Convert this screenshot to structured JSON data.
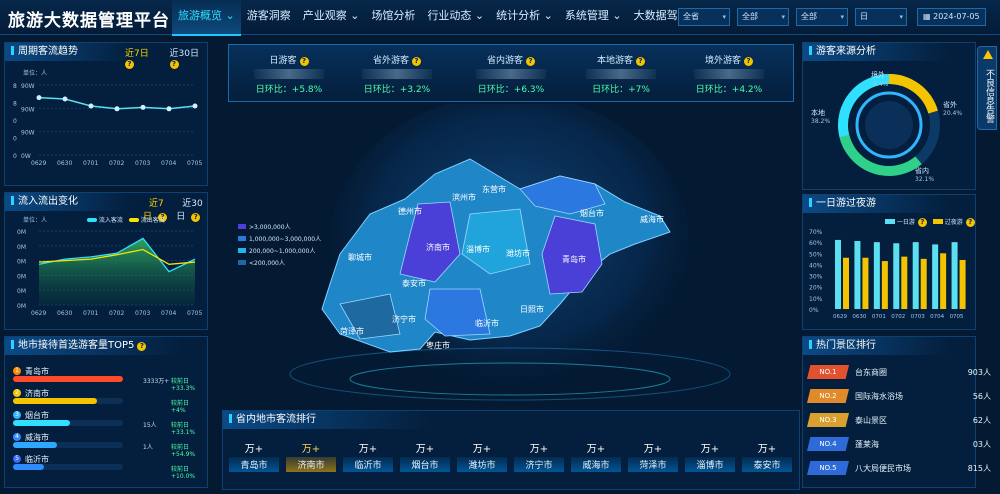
{
  "brand": "旅游大数据管理平台",
  "nav": [
    {
      "label": "旅游概览 ⌄",
      "active": true
    },
    {
      "label": "游客洞察",
      "active": false
    },
    {
      "label": "产业观察 ⌄",
      "active": false
    },
    {
      "label": "场馆分析",
      "active": false
    },
    {
      "label": "行业动态 ⌄",
      "active": false
    },
    {
      "label": "统计分析 ⌄",
      "active": false
    },
    {
      "label": "系统管理 ⌄",
      "active": false
    },
    {
      "label": "大数据驾信 ⌄",
      "active": false
    }
  ],
  "filters": [
    {
      "value": "全省"
    },
    {
      "value": "全部"
    },
    {
      "value": "全部"
    },
    {
      "value": "日"
    }
  ],
  "date": "2024-07-05",
  "colors": {
    "accent": "#24c6ff",
    "yellow": "#f5c400",
    "green": "#49ffaa"
  },
  "weekly": {
    "title": "周期客流趋势",
    "tab7": "近7日",
    "tab30": "近30日",
    "unit": "单位：人",
    "y_ticks": [
      "8",
      "8",
      "0",
      "0",
      "0"
    ],
    "y_right": [
      "90W",
      "90W",
      "90W",
      "0W"
    ],
    "chart_data": {
      "type": "line",
      "categories": [
        "0629",
        "0630",
        "0701",
        "0702",
        "0703",
        "0704",
        "0705"
      ],
      "series": [
        {
          "values": [
            0.82,
            0.8,
            0.7,
            0.66,
            0.68,
            0.66,
            0.7
          ]
        }
      ],
      "ylim": [
        0,
        1
      ]
    }
  },
  "flow": {
    "title": "流入流出变化",
    "tab7": "近7日",
    "tab30": "近30日",
    "unit": "单位：人",
    "legend_in": "流入客流",
    "legend_out": "流出客流",
    "y_ticks": [
      "0M",
      "0M",
      "0M",
      "0M",
      "0M",
      "0M"
    ],
    "chart_data": {
      "type": "area",
      "categories": [
        "0629",
        "0630",
        "0701",
        "0702",
        "0703",
        "0704",
        "0705"
      ],
      "series": [
        {
          "name": "流入客流",
          "values": [
            0.55,
            0.62,
            0.65,
            0.7,
            0.9,
            0.45,
            0.62
          ]
        },
        {
          "name": "流出客流",
          "values": [
            0.58,
            0.6,
            0.62,
            0.68,
            0.75,
            0.55,
            0.58
          ]
        }
      ],
      "ylim": [
        0,
        1
      ]
    }
  },
  "top5": {
    "title": "地市接待首选游客量TOP5",
    "items": [
      {
        "rank": "1",
        "city": "青岛市",
        "num": "3333万+",
        "change": "较前日+33.3%",
        "pct": 1.0,
        "color": "#ff4a2a",
        "badge": "#ff8a00"
      },
      {
        "rank": "2",
        "city": "济南市",
        "num": "",
        "change": "较前日+4%",
        "pct": 0.76,
        "color": "#f5c400",
        "badge": "#f5c400"
      },
      {
        "rank": "3",
        "city": "烟台市",
        "num": "15人",
        "change": "较前日+33.1%",
        "pct": 0.52,
        "color": "#2fe0ff",
        "badge": "#2fb6ff"
      },
      {
        "rank": "4",
        "city": "威海市",
        "num": "1人",
        "change": "较前日+54.9%",
        "pct": 0.4,
        "color": "#2fa8ff",
        "badge": "#2f8bff"
      },
      {
        "rank": "5",
        "city": "临沂市",
        "num": "",
        "change": "较前日+10.0%",
        "pct": 0.28,
        "color": "#2f8bff",
        "badge": "#2f6bff"
      }
    ]
  },
  "kpis": [
    {
      "label": "日游客",
      "change": "日环比：+5.8%"
    },
    {
      "label": "省外游客",
      "change": "日环比：+3.2%"
    },
    {
      "label": "省内游客",
      "change": "日环比：+6.3%"
    },
    {
      "label": "本地游客",
      "change": "日环比：+7%"
    },
    {
      "label": "境外游客",
      "change": "日环比：+4.2%"
    }
  ],
  "map": {
    "legend": [
      {
        "label": ">3,000,000人",
        "color": "#4a40d8"
      },
      {
        "label": "1,000,000~3,000,000人",
        "color": "#2a78e0"
      },
      {
        "label": "200,000~1,000,000人",
        "color": "#21b6e8"
      },
      {
        "label": "<200,000人",
        "color": "#1e6aa0"
      }
    ],
    "cities": [
      {
        "name": "德州市"
      },
      {
        "name": "滨州市"
      },
      {
        "name": "东营市"
      },
      {
        "name": "烟台市"
      },
      {
        "name": "威海市"
      },
      {
        "name": "济南市"
      },
      {
        "name": "淄博市"
      },
      {
        "name": "潍坊市"
      },
      {
        "name": "聊城市"
      },
      {
        "name": "青岛市"
      },
      {
        "name": "泰安市"
      },
      {
        "name": "日照市"
      },
      {
        "name": "济宁市"
      },
      {
        "name": "临沂市"
      },
      {
        "name": "菏泽市"
      },
      {
        "name": "枣庄市"
      }
    ]
  },
  "city_bar": {
    "title": "省内地市客流排行",
    "items": [
      {
        "val": "万+",
        "name": "青岛市",
        "active": false
      },
      {
        "val": "万+",
        "name": "济南市",
        "active": true
      },
      {
        "val": "万+",
        "name": "临沂市",
        "active": false
      },
      {
        "val": "万+",
        "name": "烟台市",
        "active": false
      },
      {
        "val": "万+",
        "name": "潍坊市",
        "active": false
      },
      {
        "val": "万+",
        "name": "济宁市",
        "active": false
      },
      {
        "val": "万+",
        "name": "威海市",
        "active": false
      },
      {
        "val": "万+",
        "name": "菏泽市",
        "active": false
      },
      {
        "val": "万+",
        "name": "淄博市",
        "active": false
      },
      {
        "val": "万+",
        "name": "泰安市",
        "active": false
      }
    ]
  },
  "source": {
    "title": "游客来源分析",
    "labels": [
      {
        "name": "境外",
        "pct": "8.4%"
      },
      {
        "name": "省外",
        "pct": "20.4%"
      },
      {
        "name": "本地",
        "pct": "38.2%"
      },
      {
        "name": "省内",
        "pct": "32.1%"
      }
    ]
  },
  "oneday": {
    "title": "一日游过夜游",
    "legend_a": "一日游",
    "legend_b": "过夜游",
    "y_ticks": [
      "70%",
      "60%",
      "50%",
      "40%",
      "30%",
      "20%",
      "10%",
      "0%"
    ],
    "chart_data": {
      "type": "bar",
      "categories": [
        "0629",
        "0630",
        "0701",
        "0702",
        "0703",
        "0704",
        "0705"
      ],
      "series": [
        {
          "name": "一日游",
          "values": [
            62,
            61,
            60,
            59,
            60,
            58,
            60
          ]
        },
        {
          "name": "过夜游",
          "values": [
            46,
            46,
            43,
            47,
            45,
            50,
            44
          ]
        }
      ],
      "ylim": [
        0,
        70
      ]
    }
  },
  "hot": {
    "title": "热门景区排行",
    "items": [
      {
        "rank": "NO.1",
        "name": "台东商圈",
        "value": "903人",
        "color": "#e2522e"
      },
      {
        "rank": "NO.2",
        "name": "国际海水浴场",
        "value": "56人",
        "color": "#e08a2a"
      },
      {
        "rank": "NO.3",
        "name": "泰山景区",
        "value": "62人",
        "color": "#d9a030"
      },
      {
        "rank": "NO.4",
        "name": "蓬莱海",
        "value": "03人",
        "color": "#2f6bd8"
      },
      {
        "rank": "NO.5",
        "name": "八大局便民市场",
        "value": "815人",
        "color": "#2f6bd8"
      }
    ]
  },
  "side_tab": "不良信息告警"
}
